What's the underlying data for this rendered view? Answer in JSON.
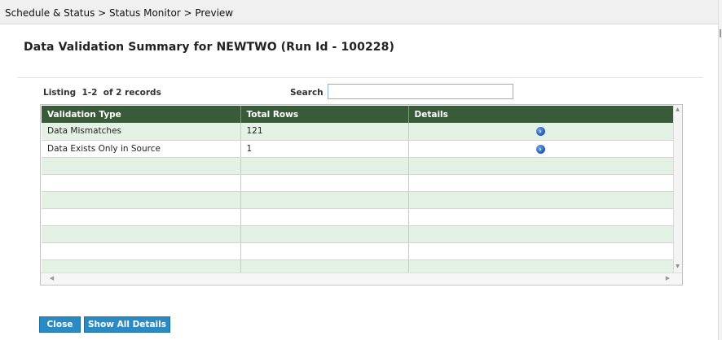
{
  "breadcrumb": "Schedule & Status > Status Monitor > Preview",
  "page_title": "Data Validation Summary for NEWTWO (Run Id - 100228)",
  "listing": "Listing  1-2  of 2 records",
  "search": {
    "label": "Search",
    "value": ""
  },
  "table": {
    "columns": [
      "Validation Type",
      "Total Rows",
      "Details"
    ],
    "rows": [
      {
        "type": "Data Mismatches",
        "total": "121",
        "details_icon": "info-icon"
      },
      {
        "type": "Data Exists Only in Source",
        "total": "1",
        "details_icon": "info-icon"
      }
    ]
  },
  "buttons": {
    "close": "Close",
    "show_all": "Show All Details"
  },
  "colors": {
    "header_bg": "#3a5b3a",
    "alt_row": "#e4f2e6",
    "button": "#2a8ac4",
    "info_icon": "#1f58b8"
  }
}
